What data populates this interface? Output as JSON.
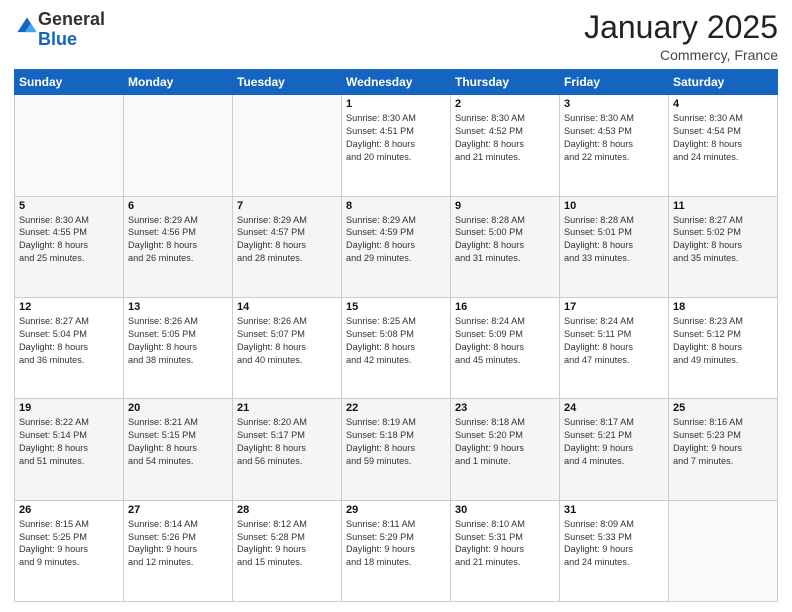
{
  "logo": {
    "general": "General",
    "blue": "Blue"
  },
  "header": {
    "month": "January 2025",
    "location": "Commercy, France"
  },
  "weekdays": [
    "Sunday",
    "Monday",
    "Tuesday",
    "Wednesday",
    "Thursday",
    "Friday",
    "Saturday"
  ],
  "weeks": [
    [
      {
        "day": "",
        "info": ""
      },
      {
        "day": "",
        "info": ""
      },
      {
        "day": "",
        "info": ""
      },
      {
        "day": "1",
        "info": "Sunrise: 8:30 AM\nSunset: 4:51 PM\nDaylight: 8 hours\nand 20 minutes."
      },
      {
        "day": "2",
        "info": "Sunrise: 8:30 AM\nSunset: 4:52 PM\nDaylight: 8 hours\nand 21 minutes."
      },
      {
        "day": "3",
        "info": "Sunrise: 8:30 AM\nSunset: 4:53 PM\nDaylight: 8 hours\nand 22 minutes."
      },
      {
        "day": "4",
        "info": "Sunrise: 8:30 AM\nSunset: 4:54 PM\nDaylight: 8 hours\nand 24 minutes."
      }
    ],
    [
      {
        "day": "5",
        "info": "Sunrise: 8:30 AM\nSunset: 4:55 PM\nDaylight: 8 hours\nand 25 minutes."
      },
      {
        "day": "6",
        "info": "Sunrise: 8:29 AM\nSunset: 4:56 PM\nDaylight: 8 hours\nand 26 minutes."
      },
      {
        "day": "7",
        "info": "Sunrise: 8:29 AM\nSunset: 4:57 PM\nDaylight: 8 hours\nand 28 minutes."
      },
      {
        "day": "8",
        "info": "Sunrise: 8:29 AM\nSunset: 4:59 PM\nDaylight: 8 hours\nand 29 minutes."
      },
      {
        "day": "9",
        "info": "Sunrise: 8:28 AM\nSunset: 5:00 PM\nDaylight: 8 hours\nand 31 minutes."
      },
      {
        "day": "10",
        "info": "Sunrise: 8:28 AM\nSunset: 5:01 PM\nDaylight: 8 hours\nand 33 minutes."
      },
      {
        "day": "11",
        "info": "Sunrise: 8:27 AM\nSunset: 5:02 PM\nDaylight: 8 hours\nand 35 minutes."
      }
    ],
    [
      {
        "day": "12",
        "info": "Sunrise: 8:27 AM\nSunset: 5:04 PM\nDaylight: 8 hours\nand 36 minutes."
      },
      {
        "day": "13",
        "info": "Sunrise: 8:26 AM\nSunset: 5:05 PM\nDaylight: 8 hours\nand 38 minutes."
      },
      {
        "day": "14",
        "info": "Sunrise: 8:26 AM\nSunset: 5:07 PM\nDaylight: 8 hours\nand 40 minutes."
      },
      {
        "day": "15",
        "info": "Sunrise: 8:25 AM\nSunset: 5:08 PM\nDaylight: 8 hours\nand 42 minutes."
      },
      {
        "day": "16",
        "info": "Sunrise: 8:24 AM\nSunset: 5:09 PM\nDaylight: 8 hours\nand 45 minutes."
      },
      {
        "day": "17",
        "info": "Sunrise: 8:24 AM\nSunset: 5:11 PM\nDaylight: 8 hours\nand 47 minutes."
      },
      {
        "day": "18",
        "info": "Sunrise: 8:23 AM\nSunset: 5:12 PM\nDaylight: 8 hours\nand 49 minutes."
      }
    ],
    [
      {
        "day": "19",
        "info": "Sunrise: 8:22 AM\nSunset: 5:14 PM\nDaylight: 8 hours\nand 51 minutes."
      },
      {
        "day": "20",
        "info": "Sunrise: 8:21 AM\nSunset: 5:15 PM\nDaylight: 8 hours\nand 54 minutes."
      },
      {
        "day": "21",
        "info": "Sunrise: 8:20 AM\nSunset: 5:17 PM\nDaylight: 8 hours\nand 56 minutes."
      },
      {
        "day": "22",
        "info": "Sunrise: 8:19 AM\nSunset: 5:18 PM\nDaylight: 8 hours\nand 59 minutes."
      },
      {
        "day": "23",
        "info": "Sunrise: 8:18 AM\nSunset: 5:20 PM\nDaylight: 9 hours\nand 1 minute."
      },
      {
        "day": "24",
        "info": "Sunrise: 8:17 AM\nSunset: 5:21 PM\nDaylight: 9 hours\nand 4 minutes."
      },
      {
        "day": "25",
        "info": "Sunrise: 8:16 AM\nSunset: 5:23 PM\nDaylight: 9 hours\nand 7 minutes."
      }
    ],
    [
      {
        "day": "26",
        "info": "Sunrise: 8:15 AM\nSunset: 5:25 PM\nDaylight: 9 hours\nand 9 minutes."
      },
      {
        "day": "27",
        "info": "Sunrise: 8:14 AM\nSunset: 5:26 PM\nDaylight: 9 hours\nand 12 minutes."
      },
      {
        "day": "28",
        "info": "Sunrise: 8:12 AM\nSunset: 5:28 PM\nDaylight: 9 hours\nand 15 minutes."
      },
      {
        "day": "29",
        "info": "Sunrise: 8:11 AM\nSunset: 5:29 PM\nDaylight: 9 hours\nand 18 minutes."
      },
      {
        "day": "30",
        "info": "Sunrise: 8:10 AM\nSunset: 5:31 PM\nDaylight: 9 hours\nand 21 minutes."
      },
      {
        "day": "31",
        "info": "Sunrise: 8:09 AM\nSunset: 5:33 PM\nDaylight: 9 hours\nand 24 minutes."
      },
      {
        "day": "",
        "info": ""
      }
    ]
  ]
}
